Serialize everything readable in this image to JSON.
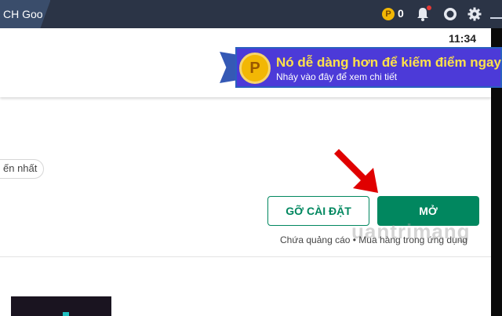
{
  "topbar": {
    "tab_title": "CH Goo",
    "coin_symbol": "P",
    "coin_count": "0",
    "icons": [
      "coin-icon",
      "bell-icon",
      "profile-icon",
      "gear-icon",
      "minimize-icon"
    ]
  },
  "status": {
    "time": "11:34"
  },
  "banner": {
    "coin_symbol": "P",
    "title": "Nó dễ dàng hơn để kiếm điểm ngay b",
    "subtitle": "Nháy vào đây để xem chi tiết"
  },
  "chip": {
    "label": "ến nhất"
  },
  "actions": {
    "uninstall_label": "GỠ CÀI ĐẶT",
    "open_label": "MỞ"
  },
  "info": {
    "line": "Chứa quảng cáo • Mua hàng trong ứng dụng"
  },
  "watermark": "uantrimang",
  "colors": {
    "accent_green": "#01875f",
    "topbar": "#2b3446",
    "banner_bg": "#4c3ad8",
    "banner_title": "#ffe24a",
    "arrow": "#e00000"
  }
}
